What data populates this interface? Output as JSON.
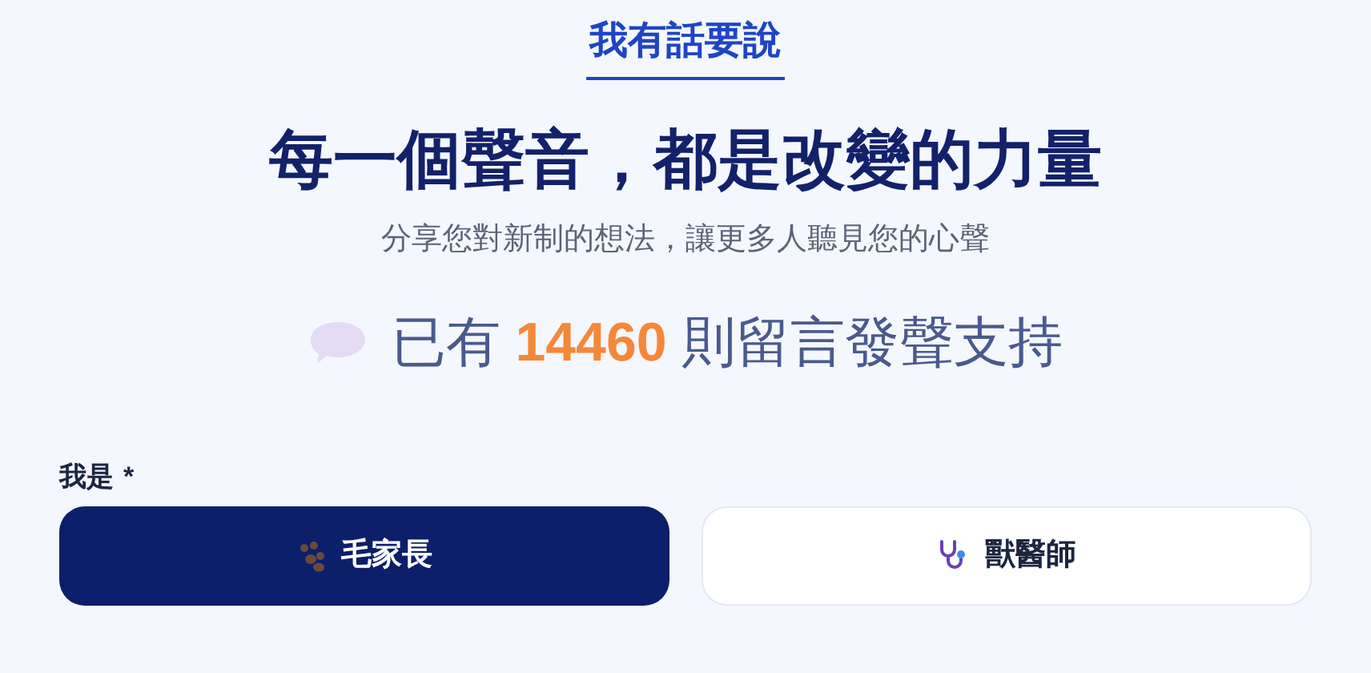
{
  "section_tag": "我有話要說",
  "headline": "每一個聲音，都是改變的力量",
  "subtitle": "分享您對新制的想法，讓更多人聽見您的心聲",
  "counter": {
    "prefix": "已有",
    "count": "14460",
    "suffix": "則留言發聲支持"
  },
  "role_field": {
    "label": "我是",
    "required_mark": "*",
    "options": [
      {
        "label": "毛家長",
        "kind": "paw",
        "selected": true
      },
      {
        "label": "獸醫師",
        "kind": "stethoscope",
        "selected": false
      }
    ]
  }
}
